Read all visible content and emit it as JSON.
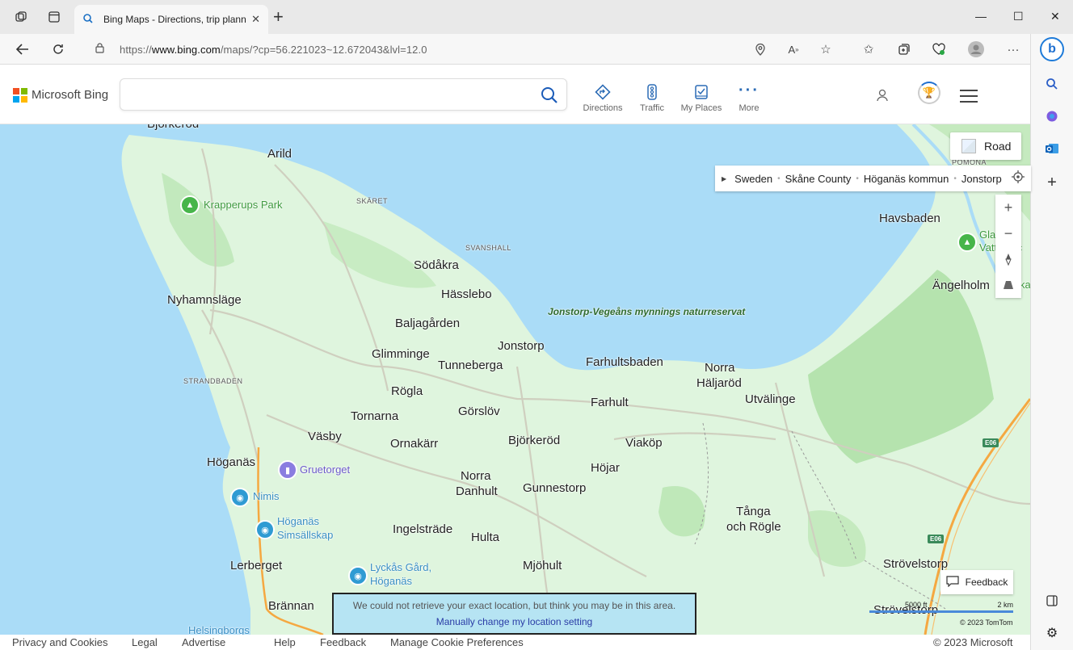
{
  "browser": {
    "tab_title": "Bing Maps - Directions, trip plann",
    "url_prefix": "https://",
    "url_host": "www.bing.com",
    "url_path": "/maps/?cp=56.221023~12.672043&lvl=12.0"
  },
  "header": {
    "brand": "Microsoft Bing",
    "search_placeholder": "",
    "nav": [
      {
        "label": "Directions",
        "icon": "directions-icon"
      },
      {
        "label": "Traffic",
        "icon": "traffic-icon"
      },
      {
        "label": "My Places",
        "icon": "my-places-icon"
      },
      {
        "label": "More",
        "icon": "more-icon"
      }
    ]
  },
  "map": {
    "style_button": "Road",
    "breadcrumb": [
      "Sweden",
      "Skåne County",
      "Höganäs kommun",
      "Jonstorp"
    ],
    "labels": {
      "bjorkerod_top": "Björkeröd",
      "arild": "Arild",
      "krapperups": "Krapperups Park",
      "skaret": "SKÄRET",
      "svanshall": "SVANSHALL",
      "sodakra": "Södåkra",
      "hasslebo": "Hässlebo",
      "nyhamnslage": "Nyhamnsläge",
      "baljagarden": "Baljagården",
      "jonstorp": "Jonstorp",
      "glimminge": "Glimminge",
      "tunneberga": "Tunneberga",
      "farhultsbaden": "Farhultsbaden",
      "norra_haljarod_1": "Norra",
      "norra_haljarod_2": "Häljaröd",
      "utvalinge": "Utvälinge",
      "strandbaden": "STRANDBADEN",
      "rogla": "Rögla",
      "farhult": "Farhult",
      "tornarna": "Tornarna",
      "gorslov": "Görslöv",
      "vasby": "Väsby",
      "ornakarr": "Ornakärr",
      "bjorkerod": "Björkeröd",
      "viakop": "Viaköp",
      "hoganas": "Höganäs",
      "gruetorget": "Gruetorget",
      "hojar": "Höjar",
      "norra_danhult_1": "Norra",
      "norra_danhult_2": "Danhult",
      "gunnestorp": "Gunnestorp",
      "nimis": "Nimis",
      "simsallskap_1": "Höganäs",
      "simsallskap_2": "Simsällskap",
      "ingelstrade": "Ingelsträde",
      "hulta": "Hulta",
      "tanga_1": "Tånga",
      "tanga_2": "och Rögle",
      "lerberget": "Lerberget",
      "mjohult": "Mjöhult",
      "lyckas_1": "Lyckås Gård,",
      "lyckas_2": "Höganäs",
      "strovelstorp": "Strövelstorp",
      "strovelstorp2": "Strövelstorp",
      "brannan": "Brännan",
      "helsingborgs": "Helsingborgs",
      "havsbaden": "Havsbaden",
      "angelholm": "Ängelholm",
      "reserve": "Jonstorp-Vegeåns mynnings naturreservat",
      "pomona": "POMONA",
      "glas_1": "Gla",
      "glas_2": "Vattentsc",
      "ska": "ka",
      "e06_a": "E06",
      "e06_b": "E06"
    },
    "scale_left": "5000 ft",
    "scale_right": "2 km",
    "copyright": "© 2023 TomTom",
    "feedback": "Feedback",
    "toast_line1": "We could not retrieve your exact location, but think you may be in this area.",
    "toast_line2": "Manually change my location setting"
  },
  "footer": {
    "links": [
      "Privacy and Cookies",
      "Legal",
      "Advertise",
      "Help",
      "Feedback",
      "Manage Cookie Preferences"
    ],
    "copyright": "© 2023 Microsoft"
  },
  "colors": {
    "water": "#aadcf7",
    "land": "#dff5de",
    "forest": "#b9e6b5",
    "road": "#c9c9b8",
    "motorway": "#f5a841"
  }
}
